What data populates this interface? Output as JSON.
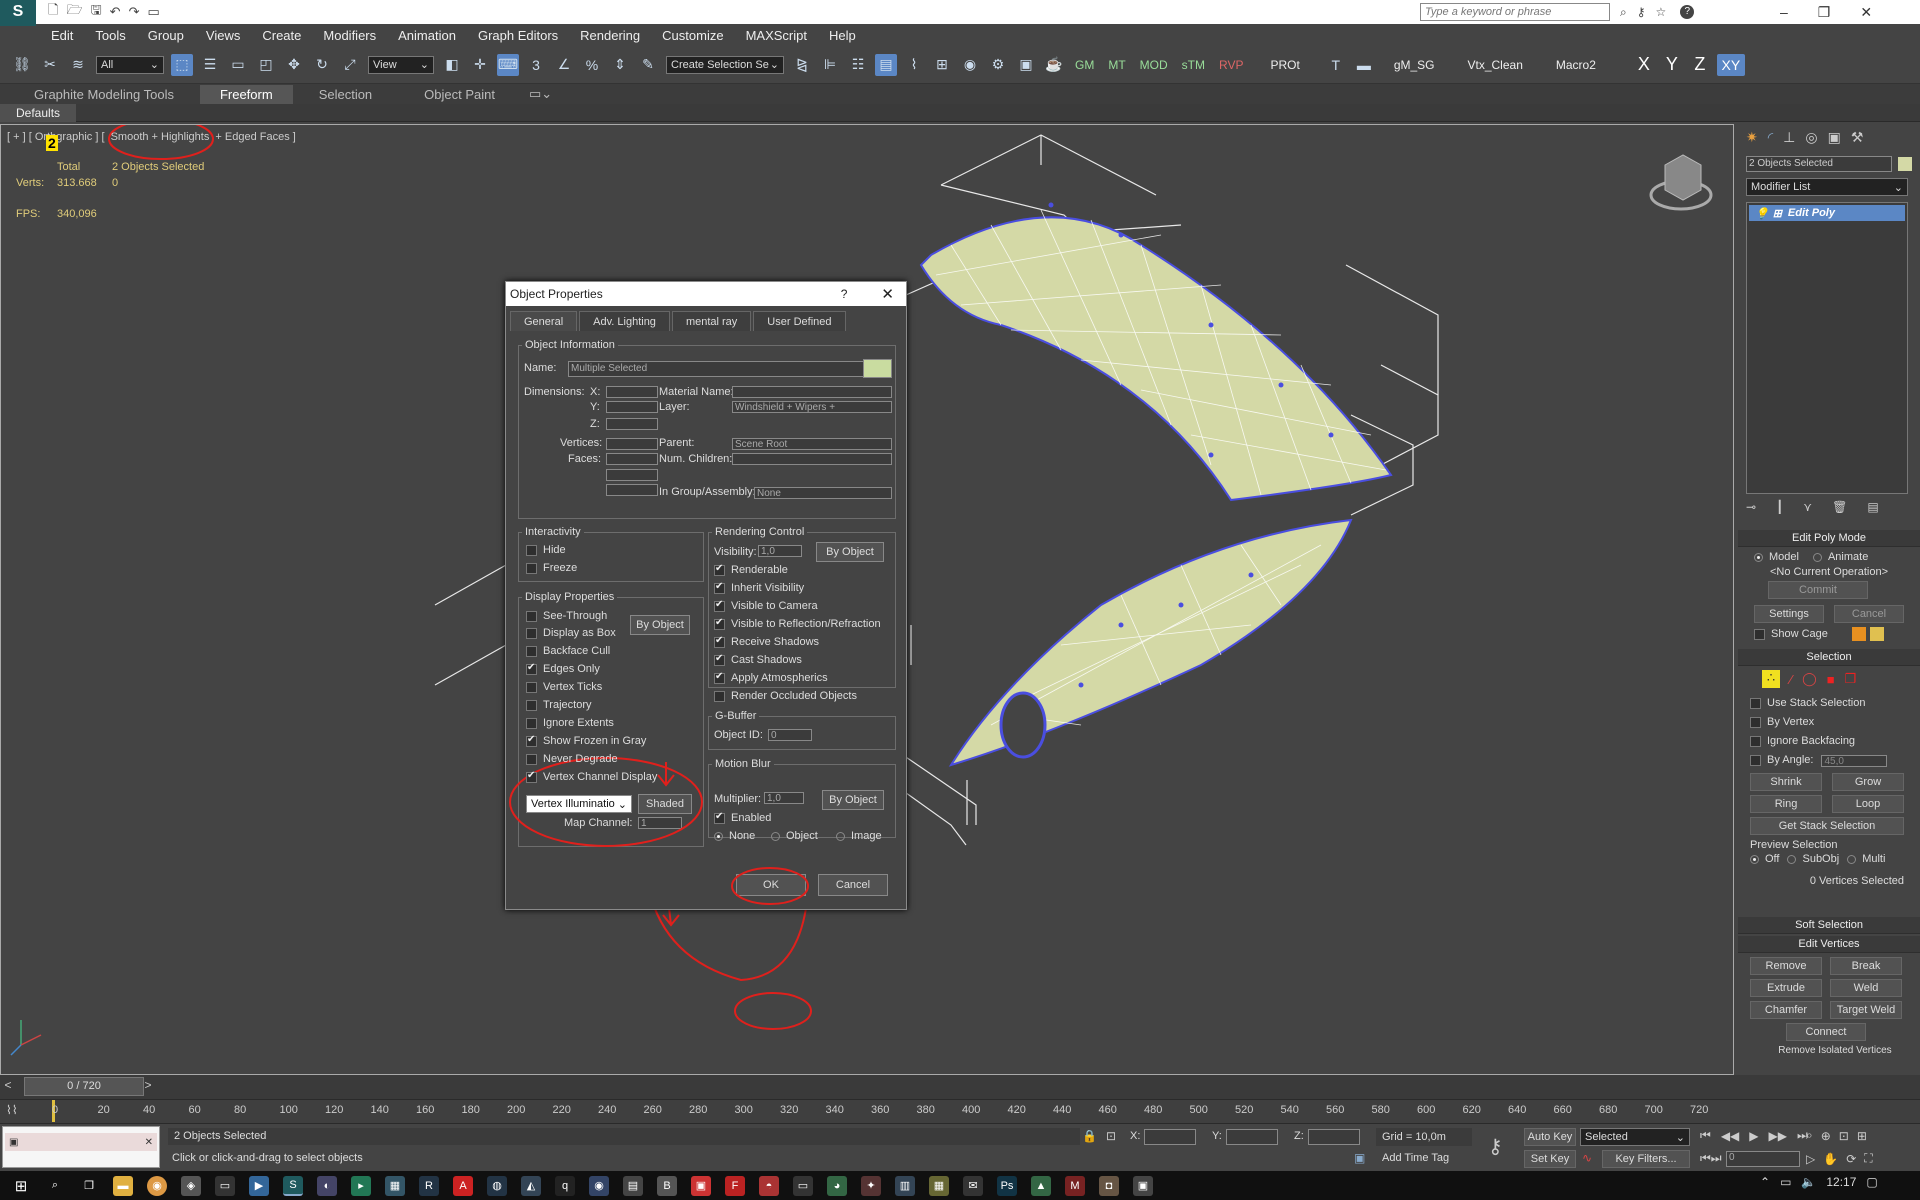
{
  "window": {
    "menu": [
      "Edit",
      "Tools",
      "Group",
      "Views",
      "Create",
      "Modifiers",
      "Animation",
      "Graph Editors",
      "Rendering",
      "Customize",
      "MAXScript",
      "Help"
    ],
    "search_placeholder": "Type a keyword or phrase"
  },
  "toolbar": {
    "selection_filter": "All",
    "ref_coord": "View",
    "named_selection": "Create Selection Se",
    "script_buttons": [
      "GM",
      "MT",
      "MOD",
      "sTM",
      "RVP",
      "PROt"
    ],
    "text_buttons": [
      "gM_SG",
      "Vtx_Clean",
      "Macro2"
    ],
    "axes": [
      "X",
      "Y",
      "Z",
      "XY"
    ]
  },
  "ribbon": {
    "tabs": [
      "Graphite Modeling Tools",
      "Freeform",
      "Selection",
      "Object Paint"
    ],
    "active_tab": "Freeform",
    "defaults": "Defaults"
  },
  "viewport": {
    "label_prefix": "[ + ] [ Orth",
    "label_suffix": "graphic ] [",
    "shading": "Smooth + Highlights",
    "label_tail": "+ Edged Faces ]",
    "marker": "2",
    "stats": {
      "total_label": "Total",
      "total_value": "2 Objects Selected",
      "verts_label": "Verts:",
      "verts_value": "313.668",
      "verts_sel": "0",
      "fps_label": "FPS:",
      "fps_value": "340,096"
    }
  },
  "dialog": {
    "title": "Object Properties",
    "help": "?",
    "tabs": [
      "General",
      "Adv. Lighting",
      "mental ray",
      "User Defined"
    ],
    "object_info": {
      "legend": "Object Information",
      "name_label": "Name:",
      "name_value": "Multiple Selected",
      "dimensions_label": "Dimensions:",
      "x": "X:",
      "y": "Y:",
      "z": "Z:",
      "vertices": "Vertices:",
      "faces": "Faces:",
      "material_label": "Material Name:",
      "layer_label": "Layer:",
      "layer_value": "Windshield + Wipers +",
      "parent_label": "Parent:",
      "parent_value": "Scene Root",
      "children_label": "Num. Children:",
      "group_label": "In Group/Assembly:",
      "group_value": "None"
    },
    "interactivity": {
      "legend": "Interactivity",
      "items": [
        {
          "label": "Hide",
          "checked": false
        },
        {
          "label": "Freeze",
          "checked": false
        }
      ]
    },
    "display": {
      "legend": "Display Properties",
      "by_object": "By Object",
      "items": [
        {
          "label": "See-Through",
          "checked": false
        },
        {
          "label": "Display as Box",
          "checked": false
        },
        {
          "label": "Backface Cull",
          "checked": false
        },
        {
          "label": "Edges Only",
          "checked": true
        },
        {
          "label": "Vertex Ticks",
          "checked": false
        },
        {
          "label": "Trajectory",
          "checked": false
        },
        {
          "label": "Ignore Extents",
          "checked": false
        },
        {
          "label": "Show Frozen in Gray",
          "checked": true
        },
        {
          "label": "Never Degrade",
          "checked": false
        },
        {
          "label": "Vertex Channel Display",
          "checked": true
        }
      ],
      "channel_select": "Vertex Illuminatio",
      "shaded": "Shaded",
      "map_channel_label": "Map Channel:",
      "map_channel_value": "1"
    },
    "rendering": {
      "legend": "Rendering Control",
      "visibility_label": "Visibility:",
      "visibility_value": "1,0",
      "by_object": "By Object",
      "items": [
        {
          "label": "Renderable",
          "checked": true
        },
        {
          "label": "Inherit Visibility",
          "checked": true
        },
        {
          "label": "Visible to Camera",
          "checked": true
        },
        {
          "label": "Visible to Reflection/Refraction",
          "checked": true
        },
        {
          "label": "Receive Shadows",
          "checked": true
        },
        {
          "label": "Cast Shadows",
          "checked": true
        },
        {
          "label": "Apply Atmospherics",
          "checked": true
        },
        {
          "label": "Render Occluded Objects",
          "checked": false
        }
      ]
    },
    "gbuffer": {
      "legend": "G-Buffer",
      "object_id_label": "Object ID:",
      "object_id_value": "0"
    },
    "motion_blur": {
      "legend": "Motion Blur",
      "multiplier_label": "Multiplier:",
      "multiplier_value": "1,0",
      "by_object": "By Object",
      "enabled": "Enabled",
      "none": "None",
      "object": "Object",
      "image": "Image"
    },
    "ok": "OK",
    "cancel": "Cancel"
  },
  "command_panel": {
    "selection_count": "2 Objects Selected",
    "modifier_list": "Modifier List",
    "stack_item": "Edit Poly",
    "edit_poly_mode": {
      "title": "Edit Poly Mode",
      "model": "Model",
      "animate": "Animate",
      "operation": "<No Current Operation>",
      "commit": "Commit",
      "settings": "Settings",
      "cancel": "Cancel",
      "show_cage": "Show Cage"
    },
    "selection": {
      "title": "Selection",
      "use_stack": "Use Stack Selection",
      "by_vertex": "By Vertex",
      "ignore_backfacing": "Ignore Backfacing",
      "by_angle": "By Angle:",
      "angle_value": "45,0",
      "shrink": "Shrink",
      "grow": "Grow",
      "ring": "Ring",
      "loop": "Loop",
      "get_stack": "Get Stack Selection",
      "preview": "Preview Selection",
      "off": "Off",
      "subobj": "SubObj",
      "multi": "Multi",
      "count": "0 Vertices Selected"
    },
    "soft_selection": "Soft Selection",
    "edit_vertices": {
      "title": "Edit Vertices",
      "remove": "Remove",
      "break": "Break",
      "extrude": "Extrude",
      "weld": "Weld",
      "chamfer": "Chamfer",
      "target_weld": "Target Weld",
      "connect": "Connect",
      "remove_isolated": "Remove Isolated Vertices"
    }
  },
  "timeline": {
    "frame": "0 / 720",
    "ticks": [
      "0",
      "20",
      "40",
      "60",
      "80",
      "100",
      "120",
      "140",
      "160",
      "180",
      "200",
      "220",
      "240",
      "260",
      "280",
      "300",
      "320",
      "340",
      "360",
      "380",
      "400",
      "420",
      "440",
      "460",
      "480",
      "500",
      "520",
      "540",
      "560",
      "580",
      "600",
      "620",
      "640",
      "660",
      "680",
      "700",
      "720"
    ]
  },
  "status": {
    "selected": "2 Objects Selected",
    "prompt": "Click or click-and-drag to select objects",
    "x_label": "X:",
    "y_label": "Y:",
    "z_label": "Z:",
    "grid": "Grid = 10,0m",
    "add_time_tag": "Add Time Tag",
    "auto_key": "Auto Key",
    "set_key": "Set Key",
    "key_mode": "Selected",
    "key_filters": "Key Filters...",
    "frame_value": "0"
  },
  "taskbar": {
    "time": "12:17"
  },
  "colors": {
    "annotation": "#e0201c",
    "mesh_fill": "#d4d9a6",
    "vertex": "#4a4ee0",
    "accent": "#5b87c5"
  }
}
